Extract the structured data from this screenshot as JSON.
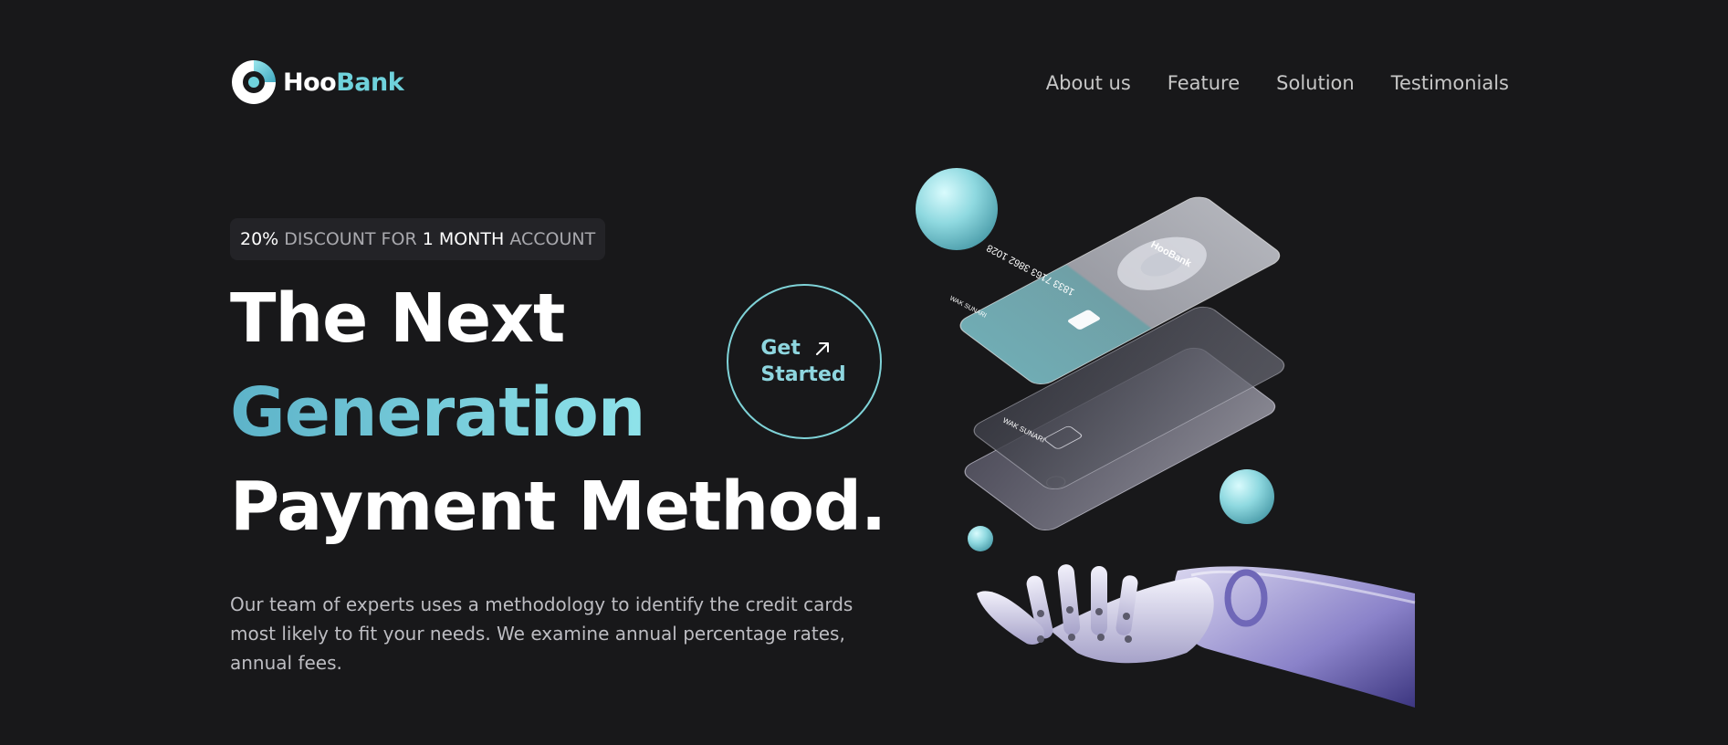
{
  "brand": {
    "name_part1": "Hoo",
    "name_part2": "Bank",
    "accent": "#6fd2dc"
  },
  "nav": {
    "items": [
      {
        "label": "About us"
      },
      {
        "label": "Feature"
      },
      {
        "label": "Solution"
      },
      {
        "label": "Testimonials"
      }
    ]
  },
  "hero": {
    "badge": {
      "percent": "20%",
      "text1": " DISCOUNT FOR ",
      "period": "1 MONTH",
      "text2": " ACCOUNT"
    },
    "headline": {
      "line1": "The Next",
      "line2": "Generation",
      "line3": "Payment Method."
    },
    "description": "Our team of experts uses a methodology to identify the credit cards most likely to fit your needs. We examine annual percentage rates, annual fees.",
    "cta": {
      "line1": "Get",
      "line2": "Started",
      "icon": "arrow-up-right-icon"
    }
  },
  "cards": {
    "top_number": "1833 7163 3862 1028",
    "holder": "WAK SUNARI",
    "brand_label": "HooBank",
    "card_number_label": "1833 7163 3862 1028"
  },
  "colors": {
    "background": "#18181a",
    "accent": "#6fd2dc",
    "gradient_start": "#5db3c9",
    "gradient_end": "#8fe3ea"
  }
}
